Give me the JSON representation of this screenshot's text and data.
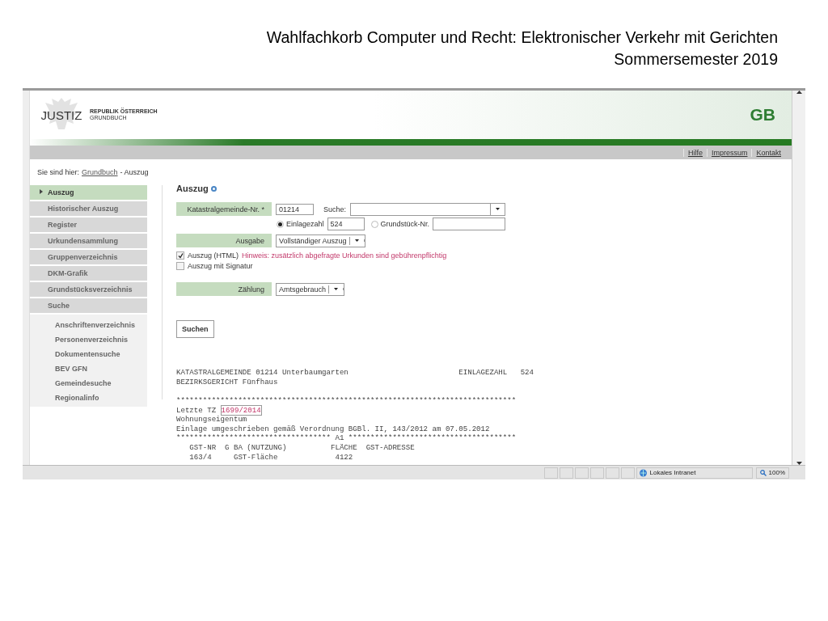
{
  "slide": {
    "title_lines": [
      "Wahlfachkorb Computer und Recht: Elektronischer Verkehr mit Gerichten",
      "Sommersemester 2019"
    ]
  },
  "header": {
    "logo": "JUSTIZ",
    "country": "REPUBLIK ÖSTERREICH",
    "register": "GRUNDBUCH",
    "badge": "GB"
  },
  "top_links": [
    "Hilfe",
    "Impressum",
    "Kontakt"
  ],
  "breadcrumb": {
    "label": "Sie sind hier:",
    "link": "Grundbuch",
    "current": "- Auszug"
  },
  "sidebar": {
    "items": [
      {
        "label": "Auszug",
        "selected": true
      },
      {
        "label": "Historischer Auszug",
        "selected": false
      },
      {
        "label": "Register",
        "selected": false
      },
      {
        "label": "Urkundensammlung",
        "selected": false
      },
      {
        "label": "Gruppenverzeichnis",
        "selected": false
      },
      {
        "label": "DKM-Grafik",
        "selected": false
      },
      {
        "label": "Grundstücksverzeichnis",
        "selected": false
      },
      {
        "label": "Suche",
        "selected": false,
        "children": [
          {
            "label": "Anschriftenverzeichnis",
            "selected": false
          },
          {
            "label": "Personenverzeichnis",
            "selected": false
          },
          {
            "label": "Dokumentensuche",
            "selected": false
          },
          {
            "label": "BEV GFN",
            "selected": false
          },
          {
            "label": "Gemeindesuche",
            "selected": false
          },
          {
            "label": "Regionalinfo",
            "selected": false
          }
        ]
      }
    ]
  },
  "form": {
    "title": "Auszug",
    "kg": {
      "label": "Katastralgemeinde-Nr. *",
      "value": "01214",
      "search_label": "Suche:"
    },
    "radios": [
      {
        "label": "Einlagezahl",
        "selected": true,
        "value": "524"
      },
      {
        "label": "Grundstück-Nr.",
        "selected": false
      }
    ],
    "ausgabe": {
      "label": "Ausgabe",
      "value": "Vollständiger Auszug"
    },
    "checks": [
      {
        "label": "Auszug (HTML)",
        "checked": true,
        "hint": "Hinweis: zusätzlich abgefragte Urkunden sind gebührenpflichtig"
      },
      {
        "label": "Auszug mit Signatur",
        "checked": false
      }
    ],
    "zaehlung": {
      "label": "Zählung",
      "value": "Amtsgebrauch"
    },
    "submit": "Suchen"
  },
  "result": {
    "lines": [
      {
        "kind": "text",
        "text": "KATASTRALGEMEINDE 01214 Unterbaumgarten                         EINLAGEZAHL   524"
      },
      {
        "kind": "text",
        "text": "BEZIRKSGERICHT Fünfhaus"
      },
      {
        "kind": "blank"
      },
      {
        "kind": "text",
        "text": "*****************************************************************************"
      },
      {
        "kind": "link",
        "text": "Letzte TZ ",
        "link": "1699/2014"
      },
      {
        "kind": "text",
        "text": "Wohnungseigentum"
      },
      {
        "kind": "text",
        "text": "Einlage umgeschrieben gemäß Verordnung BGBl. II, 143/2012 am 07.05.2012"
      },
      {
        "kind": "text",
        "text": "*********************************** A1 **************************************"
      },
      {
        "kind": "text",
        "text": "   GST-NR  G BA (NUTZUNG)          FLÄCHE  GST-ADRESSE"
      },
      {
        "kind": "text",
        "text": "   163/4     GST-Fläche             4122"
      }
    ]
  },
  "status_bar": {
    "zone": "Lokales Intranet",
    "zoom": "100%"
  }
}
